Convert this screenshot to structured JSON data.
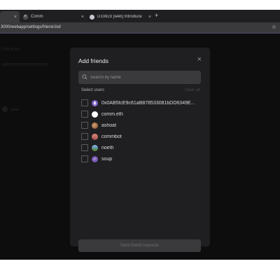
{
  "browser": {
    "tabs": [
      {
        "label": "",
        "close": "×"
      },
      {
        "label": "Comm",
        "close": "×",
        "favicon_letter": "C"
      },
      {
        "label": "D10823 [web] Introduce",
        "close": "×"
      }
    ],
    "new_tab": "+",
    "url": "3000/webapp/settings/friend-list/",
    "star": "☆"
  },
  "background": {
    "heading": "Friend list"
  },
  "modal": {
    "title": "Add friends",
    "close": "×",
    "search_placeholder": "Search by name",
    "select_label": "Select users",
    "clear_all": "Clear all",
    "send_label": "Send friend requests",
    "users": [
      {
        "name": "0x0AB5fcE9c61aB878533081bDD6349E...",
        "avatar": "ethereum-avatar",
        "color": "#7b5fc4"
      },
      {
        "name": "comm.eth",
        "avatar": "white-circle-avatar",
        "color": "#ffffff"
      },
      {
        "name": "ashoat",
        "avatar": "ashoat-avatar",
        "color": "#8a5a3c"
      },
      {
        "name": "commbot",
        "avatar": "commbot-avatar",
        "color": "#b86a5a"
      },
      {
        "name": "noeth",
        "avatar": "noeth-avatar",
        "color": "#5b8bb5"
      },
      {
        "name": "soup",
        "avatar": "soup-avatar",
        "color": "#7a5ab8"
      }
    ]
  }
}
